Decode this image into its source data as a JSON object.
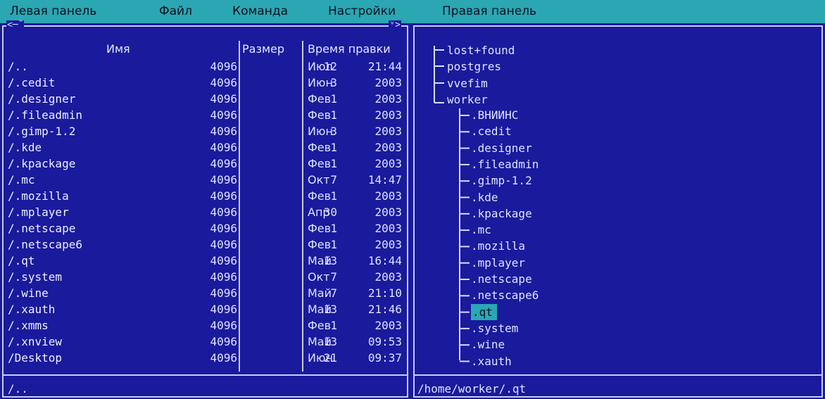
{
  "menu": [
    "Левая панель",
    "Файл",
    "Команда",
    "Настройки",
    "Правая панель"
  ],
  "left_panel": {
    "top_left_hint": "<─˜",
    "top_right_hint": "ᵛ>",
    "columns": {
      "name": "Имя",
      "size": "Размер",
      "time": "Время правки"
    },
    "rows": [
      {
        "name": "/..",
        "size": "4096",
        "mon": "Июл",
        "day": "12",
        "time": "21:44"
      },
      {
        "name": "/.cedit",
        "size": "4096",
        "mon": "Июн",
        "day": "3",
        "time": "2003"
      },
      {
        "name": "/.designer",
        "size": "4096",
        "mon": "Фев",
        "day": "1",
        "time": "2003"
      },
      {
        "name": "/.fileadmin",
        "size": "4096",
        "mon": "Фев",
        "day": "1",
        "time": "2003"
      },
      {
        "name": "/.gimp-1.2",
        "size": "4096",
        "mon": "Июн",
        "day": "3",
        "time": "2003"
      },
      {
        "name": "/.kde",
        "size": "4096",
        "mon": "Фев",
        "day": "1",
        "time": "2003"
      },
      {
        "name": "/.kpackage",
        "size": "4096",
        "mon": "Фев",
        "day": "1",
        "time": "2003"
      },
      {
        "name": "/.mc",
        "size": "4096",
        "mon": "Окт",
        "day": "7",
        "time": "14:47"
      },
      {
        "name": "/.mozilla",
        "size": "4096",
        "mon": "Фев",
        "day": "1",
        "time": "2003"
      },
      {
        "name": "/.mplayer",
        "size": "4096",
        "mon": "Апр",
        "day": "30",
        "time": "2003"
      },
      {
        "name": "/.netscape",
        "size": "4096",
        "mon": "Фев",
        "day": "1",
        "time": "2003"
      },
      {
        "name": "/.netscape6",
        "size": "4096",
        "mon": "Фев",
        "day": "1",
        "time": "2003"
      },
      {
        "name": "/.qt",
        "size": "4096",
        "mon": "Май",
        "day": "13",
        "time": "16:44"
      },
      {
        "name": "/.system",
        "size": "4096",
        "mon": "Окт",
        "day": "7",
        "time": "2003"
      },
      {
        "name": "/.wine",
        "size": "4096",
        "mon": "Май",
        "day": "7",
        "time": "21:10"
      },
      {
        "name": "/.xauth",
        "size": "4096",
        "mon": "Май",
        "day": "13",
        "time": "21:46"
      },
      {
        "name": "/.xmms",
        "size": "4096",
        "mon": "Фев",
        "day": "1",
        "time": "2003"
      },
      {
        "name": "/.xnview",
        "size": "4096",
        "mon": "Май",
        "day": "13",
        "time": "09:53"
      },
      {
        "name": "/Desktop",
        "size": "4096",
        "mon": "Июн",
        "day": "21",
        "time": "09:37"
      }
    ],
    "status": "/.."
  },
  "right_panel": {
    "tree_root": [
      "lost+found",
      "postgres",
      "vvefim",
      "worker"
    ],
    "tree_children": [
      ".ВНИИНС",
      ".cedit",
      ".designer",
      ".fileadmin",
      ".gimp-1.2",
      ".kde",
      ".kpackage",
      ".mc",
      ".mozilla",
      ".mplayer",
      ".netscape",
      ".netscape6",
      ".qt",
      ".system",
      ".wine",
      ".xauth"
    ],
    "selected": ".qt",
    "status": "/home/worker/.qt"
  },
  "colors": {
    "background": "#1a1a9c",
    "menubar": "#2aa7b3",
    "selection": "#2aa7b3",
    "border": "#c8ccf2"
  }
}
